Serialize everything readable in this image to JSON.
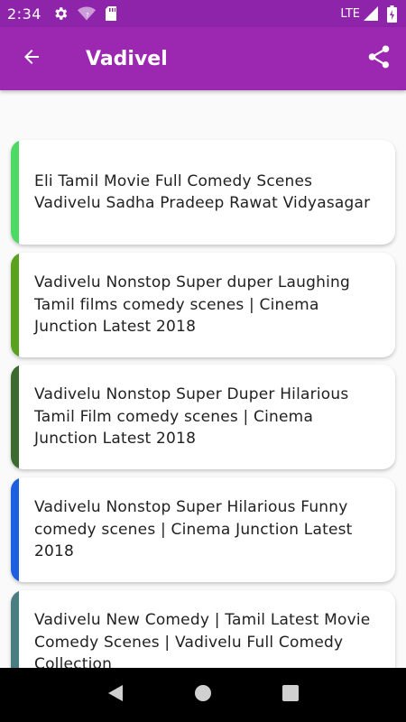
{
  "status_bar": {
    "time": "2:34",
    "network": "LTE",
    "icons": [
      "settings-icon",
      "wifi-icon",
      "sd-card-icon",
      "signal-icon",
      "battery-charging-icon"
    ]
  },
  "app_bar": {
    "title": "Vadivel",
    "back_icon": "arrow-back-icon",
    "share_icon": "share-icon",
    "color": "#9c27b0"
  },
  "videos": [
    {
      "title": "Eli Tamil Movie Full Comedy Scenes Vadivelu Sadha Pradeep Rawat Vidyasagar",
      "accent": "#4cd964"
    },
    {
      "title": "Vadivelu Nonstop Super duper Laughing Tamil films comedy scenes | Cinema Junction Latest 2018",
      "accent": "#5aa11e"
    },
    {
      "title": "Vadivelu Nonstop Super Duper Hilarious Tamil Film comedy scenes | Cinema Junction Latest 2018",
      "accent": "#3d6b2f"
    },
    {
      "title": "Vadivelu Nonstop Super Hilarious Funny comedy scenes | Cinema Junction Latest 2018",
      "accent": "#1e5fe0"
    },
    {
      "title": "Vadivelu New Comedy | Tamil Latest Movie Comedy Scenes | Vadivelu Full Comedy Collection",
      "accent": "#4a7d80"
    }
  ],
  "nav_bar": {
    "icons": [
      "back-triangle-icon",
      "home-circle-icon",
      "recents-square-icon"
    ]
  }
}
